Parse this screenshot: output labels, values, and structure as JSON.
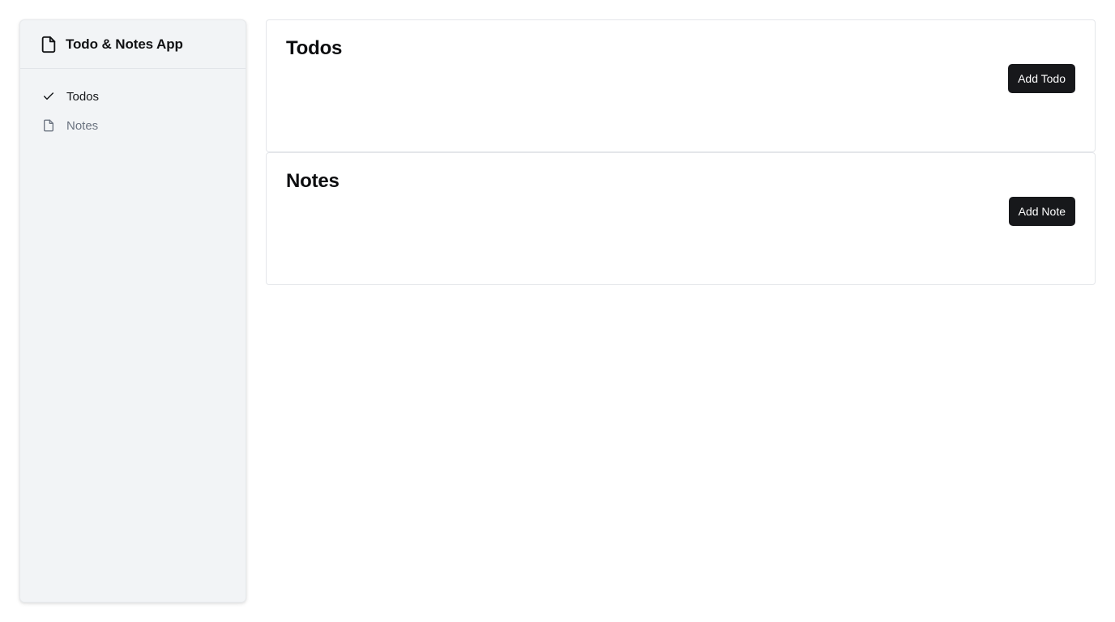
{
  "sidebar": {
    "app_title": "Todo & Notes App",
    "app_icon": "file-icon",
    "items": [
      {
        "label": "Todos",
        "icon": "check-icon",
        "active": true
      },
      {
        "label": "Notes",
        "icon": "file-icon",
        "active": false
      }
    ]
  },
  "sections": {
    "todos": {
      "title": "Todos",
      "button_label": "Add Todo"
    },
    "notes": {
      "title": "Notes",
      "button_label": "Add Note"
    }
  },
  "colors": {
    "sidebar_bg": "#f2f4f6",
    "primary_button_bg": "#17181b",
    "inactive_text": "#6b7380"
  }
}
